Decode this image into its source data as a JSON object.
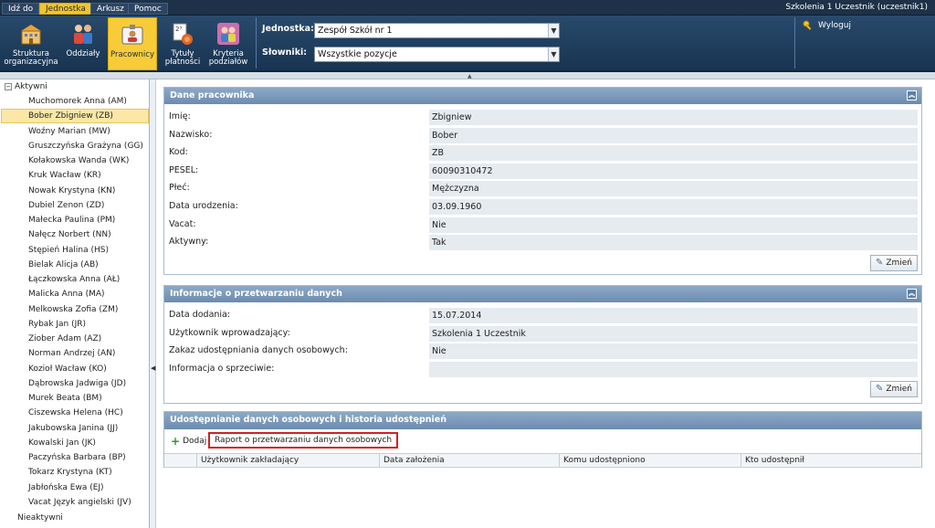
{
  "topmenu": [
    "Idź do",
    "Jednostka",
    "Arkusz",
    "Pomoc"
  ],
  "topmenu_active": "Jednostka",
  "user": "Szkolenia 1 Uczestnik (uczestnik1)",
  "logout": "Wyloguj",
  "ribbon": {
    "buttons": [
      {
        "label1": "Struktura",
        "label2": "organizacyjna",
        "icon": "building-icon"
      },
      {
        "label1": "Oddziały",
        "label2": "",
        "icon": "class-group-icon"
      },
      {
        "label1": "Pracownicy",
        "label2": "",
        "icon": "staff-card-icon"
      },
      {
        "label1": "Tytuły",
        "label2": "płatności",
        "icon": "payment-titles-icon"
      },
      {
        "label1": "Kryteria",
        "label2": "podziałów",
        "icon": "criteria-people-icon"
      }
    ],
    "active": "Pracownicy",
    "unit_label": "Jednostka:",
    "unit_value": "Zespół Szkół nr 1",
    "dict_label": "Słowniki:",
    "dict_value": "Wszystkie pozycje"
  },
  "tree": {
    "root_active": "Aktywni",
    "root_inactive": "Nieaktywni",
    "selected": "Bober Zbigniew (ZB)",
    "items": [
      "Muchomorek Anna (AM)",
      "Bober Zbigniew (ZB)",
      "Woźny Marian (MW)",
      "Gruszczyńska Grażyna (GG)",
      "Kołakowska Wanda (WK)",
      "Kruk Wacław (KR)",
      "Nowak Krystyna (KN)",
      "Dubiel Zenon (ZD)",
      "Małecka Paulina (PM)",
      "Nałęcz Norbert (NN)",
      "Stępień Halina (HS)",
      "Bielak Alicja (AB)",
      "Łączkowska Anna (AŁ)",
      "Malicka Anna (MA)",
      "Melkowska Zofia (ZM)",
      "Rybak Jan (JR)",
      "Ziober Adam (AZ)",
      "Norman Andrzej (AN)",
      "Kozioł Wacław (KO)",
      "Dąbrowska Jadwiga (JD)",
      "Murek Beata (BM)",
      "Ciszewska Helena (HC)",
      "Jakubowska Janina (JJ)",
      "Kowalski Jan (JK)",
      "Paczyńska Barbara (BP)",
      "Tokarz Krystyna (KT)",
      "Jabłońska Ewa (EJ)",
      "Vacat Język angielski (JV)"
    ]
  },
  "panel_employee": {
    "title": "Dane pracownika",
    "rows": [
      {
        "label": "Imię:",
        "value": "Zbigniew"
      },
      {
        "label": "Nazwisko:",
        "value": "Bober"
      },
      {
        "label": "Kod:",
        "value": "ZB"
      },
      {
        "label": "PESEL:",
        "value": "60090310472"
      },
      {
        "label": "Płeć:",
        "value": "Mężczyzna"
      },
      {
        "label": "Data urodzenia:",
        "value": "03.09.1960"
      },
      {
        "label": "Vacat:",
        "value": "Nie"
      },
      {
        "label": "Aktywny:",
        "value": "Tak"
      }
    ],
    "edit": "Zmień"
  },
  "panel_processing": {
    "title": "Informacje o przetwarzaniu danych",
    "rows": [
      {
        "label": "Data dodania:",
        "value": "15.07.2014"
      },
      {
        "label": "Użytkownik wprowadzający:",
        "value": "Szkolenia 1 Uczestnik"
      },
      {
        "label": "Zakaz udostępniania danych osobowych:",
        "value": "Nie"
      },
      {
        "label": "Informacja o sprzeciwie:",
        "value": ""
      }
    ],
    "edit": "Zmień"
  },
  "panel_sharing": {
    "title": "Udostępnianie danych osobowych i historia udostępnień",
    "add": "Dodaj",
    "report": "Raport o przetwarzaniu danych osobowych",
    "columns": [
      "Użytkownik zakładający",
      "Data założenia",
      "Komu udostępniono",
      "Kto udostępnił"
    ]
  }
}
